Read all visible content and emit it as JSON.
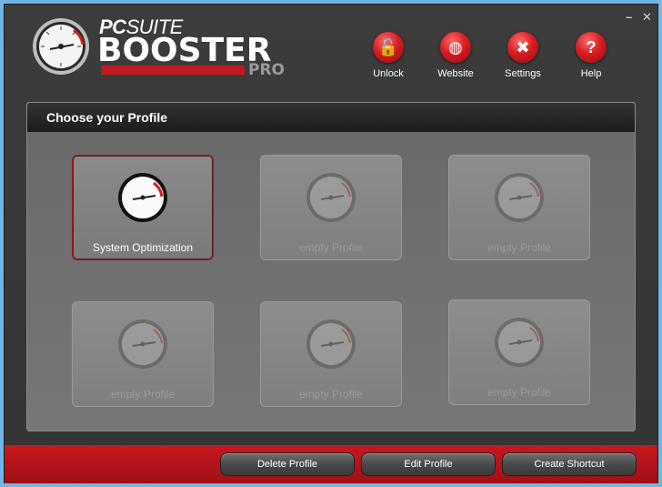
{
  "window": {
    "minimize": "–",
    "close": "✕"
  },
  "brand": {
    "line1_a": "PC",
    "line1_b": "SUITE",
    "line2": "BOOSTER",
    "edition": "PRO"
  },
  "toolbar": [
    {
      "label": "Unlock",
      "icon": "lock-icon",
      "glyph": "🔓"
    },
    {
      "label": "Website",
      "icon": "globe-icon",
      "glyph": "◍"
    },
    {
      "label": "Settings",
      "icon": "tools-icon",
      "glyph": "✖"
    },
    {
      "label": "Help",
      "icon": "help-icon",
      "glyph": "?"
    }
  ],
  "panel": {
    "title": "Choose your Profile"
  },
  "profiles": [
    {
      "label": "System Optimization",
      "active": true
    },
    {
      "label": "empty Profile",
      "active": false
    },
    {
      "label": "empty Profile",
      "active": false
    },
    {
      "label": "empty Profile",
      "active": false
    },
    {
      "label": "empty Profile",
      "active": false
    },
    {
      "label": "empty Profile",
      "active": false
    }
  ],
  "actions": {
    "delete": "Delete Profile",
    "edit": "Edit Profile",
    "shortcut": "Create Shortcut"
  },
  "colors": {
    "accent": "#c41820",
    "window_bg": "#3a3a3a",
    "panel_bg": "#727272"
  }
}
